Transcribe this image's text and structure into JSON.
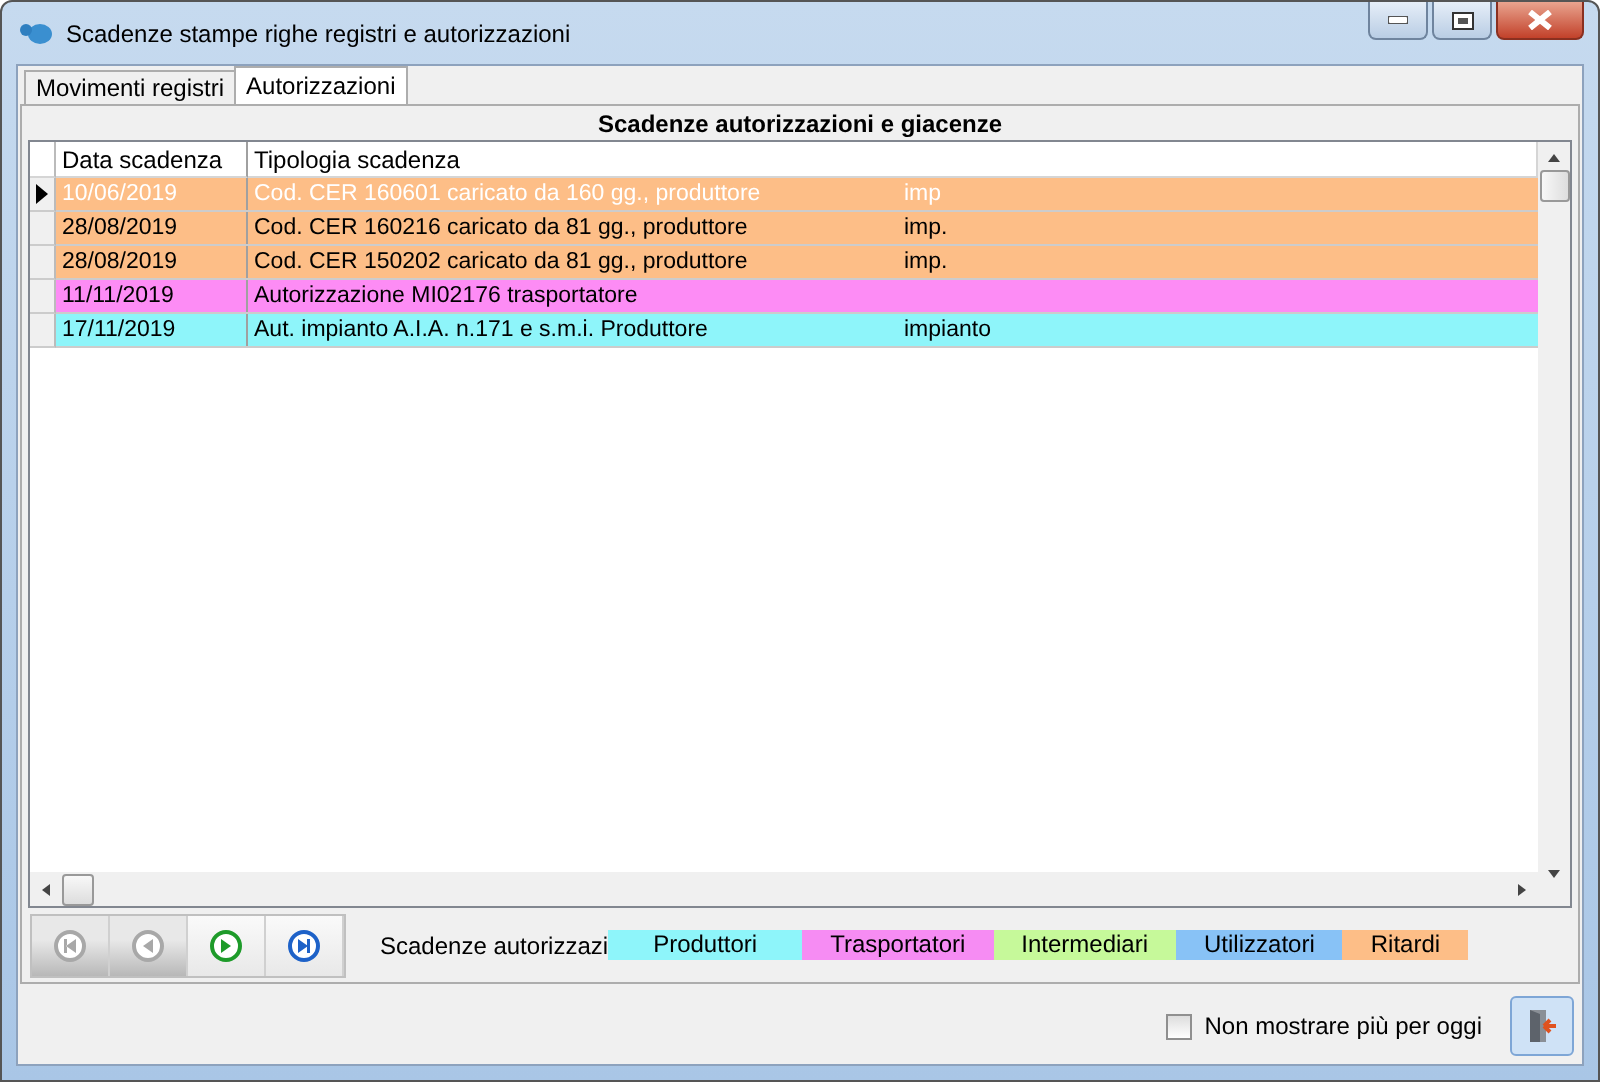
{
  "window": {
    "title": "Scadenze stampe righe registri e autorizzazioni"
  },
  "tabs": [
    {
      "label": "Movimenti registri",
      "selected": false
    },
    {
      "label": "Autorizzazioni",
      "selected": true
    }
  ],
  "panel_title": "Scadenze autorizzazioni e giacenze",
  "table": {
    "columns": [
      "Data scadenza",
      "Tipologia scadenza"
    ],
    "rows": [
      {
        "date": "10/06/2019",
        "type": "Cod. CER 160601 caricato da 160 gg., produttore",
        "suffix": "imp",
        "color": "#fdbe87",
        "selected": true
      },
      {
        "date": "28/08/2019",
        "type": "Cod. CER 160216 caricato da 81 gg., produttore",
        "suffix": "imp.",
        "color": "#fdbe87",
        "selected": false
      },
      {
        "date": "28/08/2019",
        "type": "Cod. CER 150202 caricato da 81 gg., produttore",
        "suffix": "imp.",
        "color": "#fdbe87",
        "selected": false
      },
      {
        "date": "11/11/2019",
        "type": "Autorizzazione MI02176 trasportatore",
        "color": "#fd8cf5",
        "selected": false
      },
      {
        "date": "17/11/2019",
        "type": "Aut. impianto A.I.A. n.171 e s.m.i. Produttore",
        "suffix": "impianto",
        "color": "#8ef5fa",
        "selected": false
      }
    ]
  },
  "navigator": [
    {
      "kind": "first",
      "disabled": true
    },
    {
      "kind": "prev",
      "disabled": true
    },
    {
      "kind": "next",
      "disabled": false
    },
    {
      "kind": "last",
      "disabled": false
    }
  ],
  "legend": {
    "label": "Scadenze autorizzazi",
    "items": [
      {
        "label": "Produttori",
        "color": "#8ef5fa"
      },
      {
        "label": "Trasportatori",
        "color": "#f68cf3"
      },
      {
        "label": "Intermediari",
        "color": "#c6f99a"
      },
      {
        "label": "Utilizzatori",
        "color": "#88c2f6"
      },
      {
        "label": "Ritardi",
        "color": "#fdbe87"
      }
    ]
  },
  "dont_show_today": {
    "label": "Non mostrare più per oggi",
    "checked": false
  }
}
